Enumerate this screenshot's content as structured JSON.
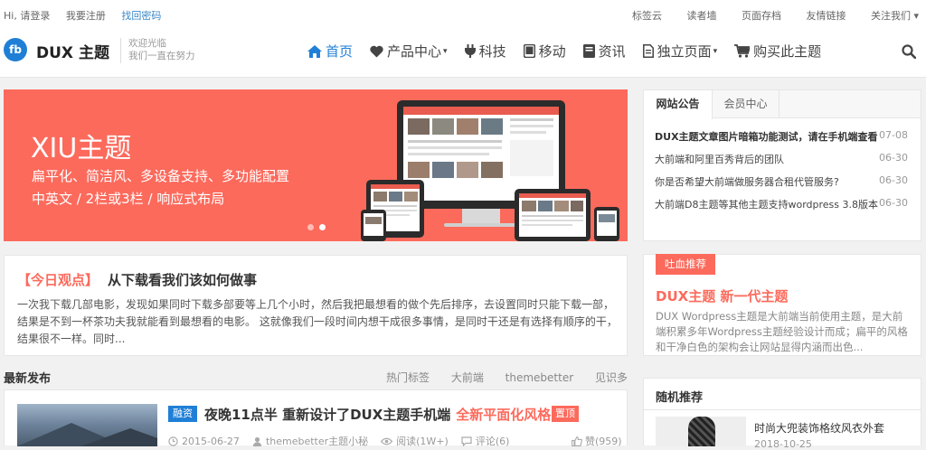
{
  "topbar": {
    "login": "Hi, 请登录",
    "register": "我要注册",
    "find_password": "找回密码",
    "links": [
      "标签云",
      "读者墙",
      "页面存档",
      "友情链接",
      "关注我们"
    ]
  },
  "header": {
    "logo_mark": "fb",
    "logo_text": "DUX 主题",
    "slogan_line1": "欢迎光临",
    "slogan_line2": "我们一直在努力",
    "nav": [
      {
        "label": "首页",
        "icon": "home-icon",
        "active": true
      },
      {
        "label": "产品中心",
        "icon": "heart-icon",
        "dropdown": true
      },
      {
        "label": "科技",
        "icon": "plug-icon"
      },
      {
        "label": "移动",
        "icon": "tablet-icon"
      },
      {
        "label": "资讯",
        "icon": "book-icon"
      },
      {
        "label": "独立页面",
        "icon": "file-icon",
        "dropdown": true
      },
      {
        "label": "购买此主题",
        "icon": "cart-icon"
      }
    ],
    "search_icon": "search-icon"
  },
  "banner": {
    "title": "XIU主题",
    "subtitle1": "扁平化、简洁风、多设备支持、多功能配置",
    "subtitle2": "中英文 / 2栏或3栏 / 响应式布局",
    "slides": 2,
    "active_slide": 2
  },
  "opinion": {
    "tag": "【今日观点】",
    "title": "从下载看我们该如何做事",
    "body": "一次我下载几部电影，发现如果同时下载多部要等上几个小时，然后我把最想看的做个先后排序，去设置同时只能下载一部，结果是不到一杯茶功夫我就能看到最想看的电影。 这就像我们一段时间内想干成很多事情，是同时干还是有选择有顺序的干，结果很不一样。同时..."
  },
  "latest": {
    "heading": "最新发布",
    "tags": [
      "热门标签",
      "大前端",
      "themebetter",
      "见识多"
    ]
  },
  "post": {
    "category": "融资",
    "title": "夜晚11点半 重新设计了DUX主题手机端",
    "title_highlight": "全新平面化风格",
    "top_label": "置顶",
    "date": "2015-06-27",
    "author": "themebetter主题小秘",
    "views": "阅读(1W+)",
    "comments": "评论(6)",
    "likes": "赞(959)"
  },
  "notice": {
    "tab_active": "网站公告",
    "tab_inactive": "会员中心",
    "items": [
      {
        "text": "DUX主题文章图片暗箱功能测试，请在手机端查看",
        "date": "07-08",
        "bold": true
      },
      {
        "text": "大前端和阿里百秀背后的团队",
        "date": "06-30"
      },
      {
        "text": "你是否希望大前端做服务器合租代管服务?",
        "date": "06-30"
      },
      {
        "text": "大前端D8主题等其他主题支持wordpress 3.8版本",
        "date": "06-30"
      }
    ]
  },
  "hot": {
    "label": "吐血推荐",
    "title": "DUX主题 新一代主题",
    "body": "DUX Wordpress主题是大前端当前使用主题，是大前端积累多年Wordpress主题经验设计而成；扁平的风格和干净白色的架构会让网站显得内涵而出色..."
  },
  "random": {
    "heading": "随机推荐",
    "item_title": "时尚大兜装饰格纹风衣外套",
    "item_date": "2018-10-25"
  },
  "colors": {
    "accent": "#1f7fd6",
    "brand_red": "#fc6a5c"
  }
}
